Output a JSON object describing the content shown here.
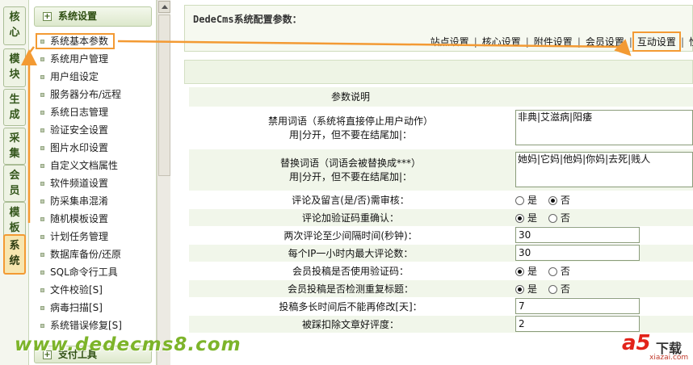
{
  "vertical_tabs": [
    {
      "label": "核心"
    },
    {
      "label": "模块"
    },
    {
      "label": "生成"
    },
    {
      "label": "采集"
    },
    {
      "label": "会员"
    },
    {
      "label": "模板"
    },
    {
      "label": "系统",
      "active": true
    }
  ],
  "menu": {
    "section_title": "系统设置",
    "items": [
      {
        "label": "系统基本参数",
        "highlighted": true
      },
      {
        "label": "系统用户管理"
      },
      {
        "label": "用户组设定"
      },
      {
        "label": "服务器分布/远程"
      },
      {
        "label": "系统日志管理"
      },
      {
        "label": "验证安全设置"
      },
      {
        "label": "图片水印设置"
      },
      {
        "label": "自定义文档属性"
      },
      {
        "label": "软件频道设置"
      },
      {
        "label": "防采集串混淆"
      },
      {
        "label": "随机模板设置"
      },
      {
        "label": "计划任务管理"
      },
      {
        "label": "数据库备份/还原"
      },
      {
        "label": "SQL命令行工具"
      },
      {
        "label": "文件校验[S]"
      },
      {
        "label": "病毒扫描[S]"
      },
      {
        "label": "系统错误修复[S]"
      }
    ],
    "footer_title": "支付工具"
  },
  "main": {
    "title": "DedeCms系统配置参数：",
    "tabs": [
      {
        "label": "站点设置"
      },
      {
        "label": "核心设置"
      },
      {
        "label": "附件设置"
      },
      {
        "label": "会员设置"
      },
      {
        "label": "互动设置",
        "highlighted": true
      },
      {
        "label": "性"
      }
    ],
    "tab_separator": "|",
    "table_header": "参数说明",
    "rows": [
      {
        "label": "禁用词语（系统将直接停止用户动作）",
        "label2": "用|分开，但不要在结尾加|：",
        "type": "textarea",
        "value": "非典|艾滋病|阳痿"
      },
      {
        "label": "替换词语（词语会被替换成***）",
        "label2": "用|分开，但不要在结尾加|：",
        "type": "textarea",
        "value": "她妈|它妈|他妈|你妈|去死|贱人"
      },
      {
        "label": "评论及留言(是/否)需审核：",
        "type": "radio",
        "options": [
          "是",
          "否"
        ],
        "selected": 1
      },
      {
        "label": "评论加验证码重确认：",
        "type": "radio",
        "options": [
          "是",
          "否"
        ],
        "selected": 0
      },
      {
        "label": "两次评论至少间隔时间(秒钟)：",
        "type": "text",
        "value": "30"
      },
      {
        "label": "每个IP一小时内最大评论数：",
        "type": "text",
        "value": "30"
      },
      {
        "label": "会员投稿是否使用验证码：",
        "type": "radio",
        "options": [
          "是",
          "否"
        ],
        "selected": 0
      },
      {
        "label": "会员投稿是否检测重复标题：",
        "type": "radio",
        "options": [
          "是",
          "否"
        ],
        "selected": 0
      },
      {
        "label": "投稿多长时间后不能再修改[天]：",
        "type": "text",
        "value": "7"
      },
      {
        "label": "被踩扣除文章好评度：",
        "type": "text",
        "value": "2"
      }
    ]
  },
  "watermark": {
    "site_url": "www.dedecms8.com",
    "logo_big": "a5",
    "logo_cn": "下载",
    "logo_small": "xiazai.com"
  },
  "colors": {
    "highlight_orange": "#f39a33",
    "panel_green": "#eef4e5",
    "watermark_green": "#7db42a"
  }
}
